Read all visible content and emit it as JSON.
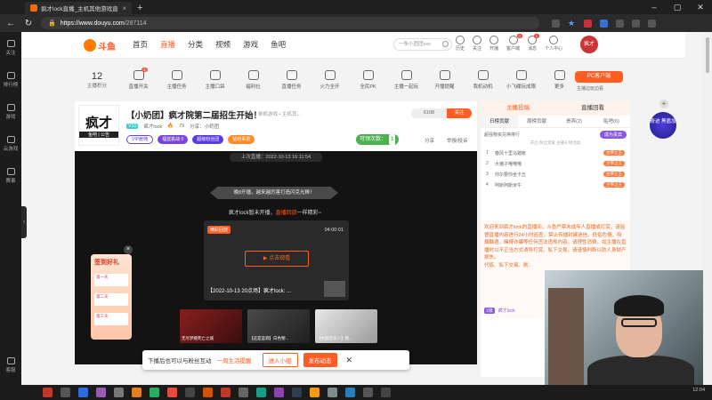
{
  "browser": {
    "tab_title": "疯才lock直播_主机其他游戏直播",
    "url_host": "https://www.douyu.com",
    "url_path": "/287114"
  },
  "sidebar": {
    "items": [
      {
        "label": "关注",
        "icon": "heart-icon"
      },
      {
        "label": "排行榜",
        "icon": "trophy-icon"
      },
      {
        "label": "游戏",
        "icon": "gamepad-icon"
      },
      {
        "label": "云游戏",
        "icon": "cloud-game-icon"
      },
      {
        "label": "赛事",
        "icon": "cup-icon"
      }
    ],
    "bottom_label": "客服"
  },
  "header": {
    "logo_text": "斗鱼",
    "nav": [
      "首页",
      "直播",
      "分类",
      "视频",
      "游戏",
      "鱼吧"
    ],
    "search_placeholder": "一条小团团sss",
    "icons": [
      {
        "label": "历史",
        "icon": "history-icon",
        "badge": ""
      },
      {
        "label": "关注",
        "icon": "follow-icon",
        "badge": ""
      },
      {
        "label": "开播",
        "icon": "broadcast-icon",
        "badge": ""
      },
      {
        "label": "客户端",
        "icon": "client-icon",
        "badge": "4"
      },
      {
        "label": "消息",
        "icon": "message-icon",
        "badge": "1"
      },
      {
        "label": "个人中心",
        "icon": "user-center-icon",
        "badge": ""
      }
    ],
    "avatar_text": "疯才"
  },
  "featbar": {
    "level_num": "12",
    "level_label": "主播积分",
    "items": [
      {
        "label": "直播开关",
        "badge": "1"
      },
      {
        "label": "主播任务",
        "badge": ""
      },
      {
        "label": "主播口袋",
        "badge": ""
      },
      {
        "label": "福利社",
        "badge": ""
      },
      {
        "label": "直播任务",
        "badge": ""
      },
      {
        "label": "火力全开",
        "badge": ""
      },
      {
        "label": "全民PK",
        "badge": ""
      },
      {
        "label": "主播一起玩",
        "badge": ""
      },
      {
        "label": "开播提醒",
        "badge": ""
      },
      {
        "label": "我机动机",
        "badge": ""
      },
      {
        "label": "小飞碟玩成限",
        "badge": ""
      },
      {
        "label": "更多",
        "badge": ""
      }
    ],
    "pc_client": "PC客户端",
    "pc_sub": "主播边玩边看"
  },
  "room": {
    "avatar_big": "疯才",
    "avatar_small": "鱼吧 | 公告",
    "title": "【小奶团】疯才院第二届招生开始！",
    "tag": "单机游戏 • 主机其...",
    "level": "V11",
    "name": "疯才lock",
    "heat": "79",
    "share_count": "分享：小奶团",
    "badges": [
      "VIP雇佣",
      "福蓝挑战 0",
      "超级粉丝团",
      "钻粉事费"
    ],
    "fans": "6108",
    "follow": "关注",
    "view_label": "可领次数：",
    "view_num": "1",
    "share": "分享",
    "report": "举报/投诉"
  },
  "player": {
    "last_live": "上次直播：2022-10-13 16:11:54",
    "banner": "晚8开播，越来越厉害打造闪克光棒！",
    "offline_msg_a": "疯才lock暂未开播，",
    "offline_msg_link": "直播回放",
    "offline_msg_b": "一样精彩~",
    "replay_hot": "精彩回放",
    "replay_dur": "04:00:01",
    "replay_play": "点击观看",
    "replay_caption": "【2022-10-13 20点场】疯才lock: ...",
    "thumbs": [
      "无尽梦魇死亡之城",
      "【这是蓝调】白色物...",
      "【中国音乐人】我..."
    ]
  },
  "follow_bar": {
    "msg": "下播后也可以与粉丝互动",
    "link": "一周生活提醒",
    "btn1": "进入小组",
    "btn2": "发布动态"
  },
  "checkin": {
    "title": "签到好礼",
    "rewards": [
      "第一天",
      "第二天",
      "第三天"
    ]
  },
  "rpanel": {
    "tabs": [
      "主播投稿",
      "直播回看"
    ],
    "subtabs": [
      "日榜贡献",
      "周榜贡献",
      "贵宾(2)",
      "贴吧(6)"
    ],
    "tip": "超强物资兑换排行",
    "join": "成为贵宾",
    "sub": "开启 粉丝宠爱 主播礼物活动",
    "ranks": [
      {
        "no": "1",
        "name": "春风十里马踏帐",
        "chip": "主宰之王"
      },
      {
        "no": "2",
        "name": "大猪子哦哦哦",
        "chip": "主宰之王"
      },
      {
        "no": "3",
        "name": "你尔要你坐卡丘",
        "chip": "主宰之王"
      },
      {
        "no": "4",
        "name": "阿斯阿斯米牛",
        "chip": "主宰之王"
      }
    ],
    "chat": "欢迎来到疯才lock的直播间，斗鱼严禁未成年人直播或打赏，请监督直播内容进行24小时巡查，禁止传播封建迷信、低俗色情、吸烟酗酒、赌博诈骗等任何违法违规内容。请理性消费，如主播在直播时以不正当方式诱导打赏、私下交易，请谨慎判断以防人身财产损失。",
    "chat_2": "代练、私下交易、刷...",
    "chat_user_lv": "1级",
    "chat_user": "疯才lock"
  },
  "float_right": "奇迹 黑盾加",
  "taskbar_time": "12:04"
}
